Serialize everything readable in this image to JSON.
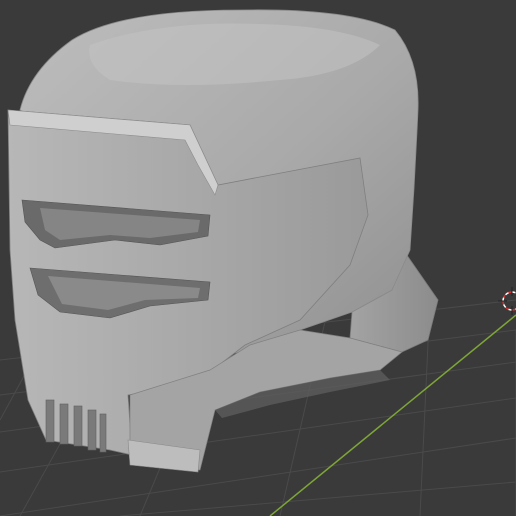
{
  "viewport": {
    "type": "3d-viewport",
    "shading": "solid",
    "background_color": "#3a3a3a",
    "grid_color": "#4a4a4a",
    "grid_axis_y_color": "#7ea637",
    "object_color": "#a6a6a6",
    "object": "helmet-mesh"
  },
  "icons": {
    "origin_cursor": "3d-cursor-icon"
  }
}
